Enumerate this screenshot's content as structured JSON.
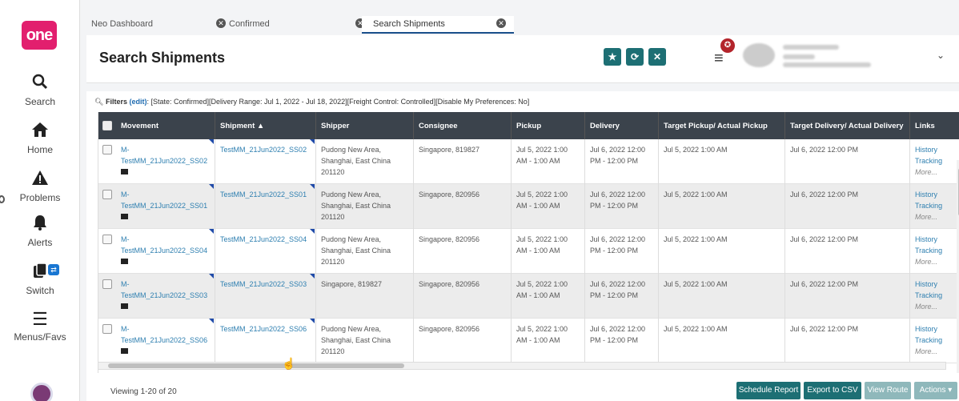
{
  "sidebar": {
    "logo": "one",
    "items": [
      {
        "label": "Search",
        "icon": "search-icon"
      },
      {
        "label": "Home",
        "icon": "home-icon"
      },
      {
        "label": "Problems",
        "icon": "warning-icon"
      },
      {
        "label": "Alerts",
        "icon": "bell-icon"
      },
      {
        "label": "Switch",
        "icon": "switch-icon"
      },
      {
        "label": "Menus/Favs",
        "icon": "hamburger-icon"
      }
    ]
  },
  "tabs": [
    {
      "label": "Neo Dashboard"
    },
    {
      "label": "Confirmed"
    },
    {
      "label": "Search Shipments",
      "active": true
    }
  ],
  "header": {
    "title": "Search Shipments",
    "actions": [
      "star-icon",
      "refresh-icon",
      "close-icon"
    ],
    "notification_count": "✪"
  },
  "filters": {
    "prefix": "Filters",
    "edit": "(edit)",
    "text": "[State: Confirmed][Delivery Range: Jul 1, 2022 - Jul 18, 2022][Freight Control: Controlled][Disable My Preferences: No]"
  },
  "table": {
    "columns": [
      "Movement",
      "Shipment ▲",
      "Shipper",
      "Consignee",
      "Pickup",
      "Delivery",
      "Target Pickup/ Actual Pickup",
      "Target Delivery/ Actual Delivery",
      "Links"
    ],
    "rows": [
      {
        "movement": "M-TestMM_21Jun2022_SS02",
        "shipment": "TestMM_21Jun2022_SS02",
        "shipper": "Pudong New Area, Shanghai, East China 201120",
        "consignee": "Singapore, 819827",
        "pickup": "Jul 5, 2022 1:00 AM - 1:00 AM",
        "delivery": "Jul 6, 2022 12:00 PM - 12:00 PM",
        "target_pickup": "Jul 5, 2022 1:00 AM",
        "target_delivery": "Jul 6, 2022 12:00 PM",
        "links": [
          "History",
          "Tracking",
          "More..."
        ]
      },
      {
        "movement": "M-TestMM_21Jun2022_SS01",
        "shipment": "TestMM_21Jun2022_SS01",
        "shipper": "Pudong New Area, Shanghai, East China 201120",
        "consignee": "Singapore, 820956",
        "pickup": "Jul 5, 2022 1:00 AM - 1:00 AM",
        "delivery": "Jul 6, 2022 12:00 PM - 12:00 PM",
        "target_pickup": "Jul 5, 2022 1:00 AM",
        "target_delivery": "Jul 6, 2022 12:00 PM",
        "links": [
          "History",
          "Tracking",
          "More..."
        ]
      },
      {
        "movement": "M-TestMM_21Jun2022_SS04",
        "shipment": "TestMM_21Jun2022_SS04",
        "shipper": "Pudong New Area, Shanghai, East China 201120",
        "consignee": "Singapore, 820956",
        "pickup": "Jul 5, 2022 1:00 AM - 1:00 AM",
        "delivery": "Jul 6, 2022 12:00 PM - 12:00 PM",
        "target_pickup": "Jul 5, 2022 1:00 AM",
        "target_delivery": "Jul 6, 2022 12:00 PM",
        "links": [
          "History",
          "Tracking",
          "More..."
        ]
      },
      {
        "movement": "M-TestMM_21Jun2022_SS03",
        "shipment": "TestMM_21Jun2022_SS03",
        "shipper": "Singapore, 819827",
        "consignee": "Singapore, 820956",
        "pickup": "Jul 5, 2022 1:00 AM - 1:00 AM",
        "delivery": "Jul 6, 2022 12:00 PM - 12:00 PM",
        "target_pickup": "Jul 5, 2022 1:00 AM",
        "target_delivery": "Jul 6, 2022 12:00 PM",
        "links": [
          "History",
          "Tracking",
          "More..."
        ]
      },
      {
        "movement": "M-TestMM_21Jun2022_SS06",
        "shipment": "TestMM_21Jun2022_SS06",
        "shipper": "Pudong New Area, Shanghai, East China 201120",
        "consignee": "Singapore, 820956",
        "pickup": "Jul 5, 2022 1:00 AM - 1:00 AM",
        "delivery": "Jul 6, 2022 12:00 PM - 12:00 PM",
        "target_pickup": "Jul 5, 2022 1:00 AM",
        "target_delivery": "Jul 6, 2022 12:00 PM",
        "links": [
          "History",
          "Tracking",
          "More..."
        ]
      }
    ]
  },
  "footer": {
    "viewing": "Viewing 1-20 of 20",
    "buttons": [
      "Schedule Report",
      "Export to CSV",
      "View Route",
      "Actions ▾"
    ]
  },
  "colors": {
    "brand": "#e21f6e",
    "header_dark": "#3b434c",
    "teal": "#1d6f74",
    "link": "#2e7fb0"
  }
}
